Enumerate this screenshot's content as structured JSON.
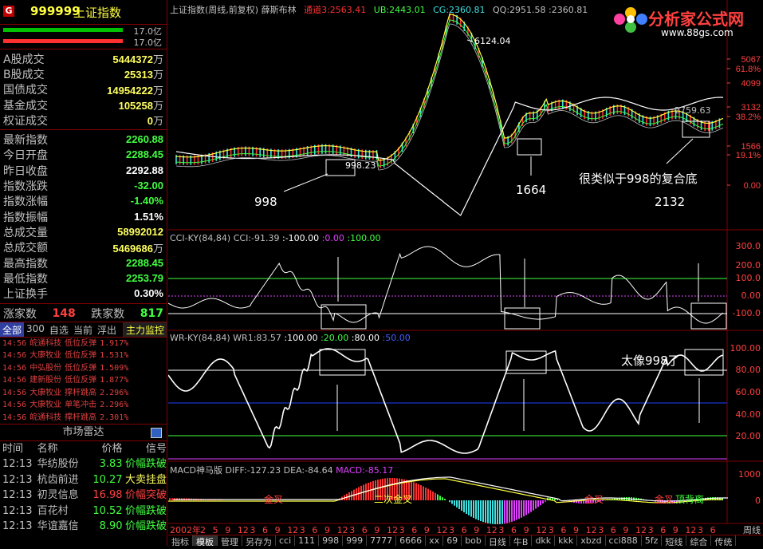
{
  "header": {
    "logo": "G",
    "code": "999999",
    "name": "上证指数"
  },
  "volume_bars": [
    {
      "value": "17.0亿",
      "color": "#00c000"
    },
    {
      "value": "17.0亿",
      "color": "#ff3030"
    }
  ],
  "turnover": [
    {
      "label": "A股成交",
      "value": "5444372",
      "unit": "万",
      "color": "#ffff60"
    },
    {
      "label": "B股成交",
      "value": "25313",
      "unit": "万",
      "color": "#ffff60"
    },
    {
      "label": "国债成交",
      "value": "14954222",
      "unit": "万",
      "color": "#ffff60"
    },
    {
      "label": "基金成交",
      "value": "105258",
      "unit": "万",
      "color": "#ffff60"
    },
    {
      "label": "权证成交",
      "value": "0",
      "unit": "万",
      "color": "#ffff60"
    }
  ],
  "stats": [
    {
      "label": "最新指数",
      "value": "2260.88",
      "color": "#40ff40"
    },
    {
      "label": "今日开盘",
      "value": "2288.45",
      "color": "#40ff40"
    },
    {
      "label": "昨日收盘",
      "value": "2292.88",
      "color": "#ffffff"
    },
    {
      "label": "指数涨跌",
      "value": "-32.00",
      "color": "#40ff40"
    },
    {
      "label": "指数涨幅",
      "value": "-1.40%",
      "color": "#40ff40"
    },
    {
      "label": "指数振幅",
      "value": "1.51%",
      "color": "#ffffff"
    },
    {
      "label": "总成交量",
      "value": "58992012",
      "color": "#ffff60"
    },
    {
      "label": "总成交额",
      "value": "5469686",
      "unit": "万",
      "color": "#ffff60"
    },
    {
      "label": "最高指数",
      "value": "2288.45",
      "color": "#40ff40"
    },
    {
      "label": "最低指数",
      "value": "2253.79",
      "color": "#40ff40"
    },
    {
      "label": "上证换手",
      "value": "0.30%",
      "color": "#ffffff"
    }
  ],
  "updown": {
    "up_label": "涨家数",
    "up": "148",
    "down_label": "跌家数",
    "down": "817"
  },
  "tabs": [
    "全部",
    "300",
    "自选",
    "当前",
    "浮出"
  ],
  "tab_main": "主力监控",
  "monitor": [
    [
      "14:56",
      "皖通科技",
      "低位反弹",
      "1.917%"
    ],
    [
      "14:56",
      "大康牧业",
      "低位反弹",
      "1.531%"
    ],
    [
      "14:56",
      "中弘股份",
      "低位反弹",
      "1.509%"
    ],
    [
      "14:56",
      "建新股份",
      "低位反弹",
      "1.877%"
    ],
    [
      "14:56",
      "大康牧业",
      "撑杆跳高",
      "2.296%"
    ],
    [
      "14:56",
      "大康牧业",
      "单笔冲击",
      "2.296%"
    ],
    [
      "14:56",
      "皖通科技",
      "撑杆跳高",
      "2.301%"
    ]
  ],
  "radar": {
    "title": "市场雷达",
    "columns": [
      "时间",
      "名称",
      "价格",
      "信号"
    ],
    "rows": [
      [
        "12:13",
        "华纺股份",
        "3.83",
        "价幅跌破"
      ],
      [
        "12:13",
        "杭齿前进",
        "10.27",
        "大卖挂盘"
      ],
      [
        "12:13",
        "初灵信息",
        "16.98",
        "价幅突破"
      ],
      [
        "12:13",
        "百花村",
        "10.52",
        "价幅跌破"
      ],
      [
        "12:13",
        "华谊嘉信",
        "8.90",
        "价幅跌破"
      ]
    ]
  },
  "main_header": {
    "title": "上证指数(周线,前复权)",
    "indicator": "薛斯布林",
    "tongdao": "通道3:2563.41",
    "ub": "UB:2443.01",
    "cg": "CG:2360.81",
    "qq": "QQ:2951.58",
    "last": ":2360.81"
  },
  "brand": {
    "text": "分析家公式网",
    "url": "www.88gs.com"
  },
  "price_axis": [
    "5067",
    "61.8%",
    "4099",
    "3132",
    "38.2%",
    "1566",
    "19.1%",
    "0.00"
  ],
  "annotations": {
    "peak": "6124.04",
    "low": "998.23",
    "lbl998": "998",
    "lbl1664": "1664",
    "lbl2132": "2132",
    "similar": "很类似于998的复合底",
    "right_price": "2759.63",
    "like998": "太像998了"
  },
  "cci_header": {
    "name": "CCI-KY(84,84)",
    "cci": "CCI:-91.39",
    "a": ":-100.00",
    "b": ":0.00",
    "c": ":100.00"
  },
  "cci_axis": [
    "300.0",
    "200.0",
    "100.0",
    "0.00",
    "-100.0"
  ],
  "wr_header": {
    "name": "WR-KY(84,84)",
    "wr": "WR1:83.57",
    "a": ":100.00",
    "b": ":20.00",
    "c": ":80.00",
    "d": ":50.00"
  },
  "wr_axis": [
    "100.00",
    "80.00",
    "60.00",
    "40.00",
    "20.00"
  ],
  "macd_header": {
    "name": "MACD神马版",
    "diff": "DIFF:-127.23",
    "dea": "DEA:-84.64",
    "macd": "MACD:-85.17"
  },
  "macd_axis": [
    "1000",
    "0"
  ],
  "macd_labels": [
    "金叉",
    "二次金叉",
    "金叉",
    "金叉",
    "顶背离"
  ],
  "xaxis": [
    "2002年",
    "2",
    "5",
    "9",
    "12",
    "3",
    "6",
    "9",
    "12",
    "3",
    "6",
    "9",
    "12",
    "3",
    "6",
    "9",
    "12",
    "3",
    "6",
    "9",
    "12",
    "3",
    "6",
    "9",
    "12",
    "3",
    "6",
    "9",
    "12",
    "3",
    "6",
    "9",
    "12",
    "3",
    "6",
    "9",
    "12",
    "3",
    "6",
    "9",
    "12",
    "3",
    "6"
  ],
  "period": "周线",
  "bottom_tabs": [
    "指标",
    "模板",
    "管理",
    "另存为",
    "cci",
    "111",
    "998",
    "999",
    "7777",
    "6666",
    "xx",
    "69",
    "bob",
    "日线",
    "牛B",
    "dkk",
    "kkk",
    "xbzd",
    "cci888",
    "5fz",
    "短线",
    "综合",
    "传统"
  ]
}
